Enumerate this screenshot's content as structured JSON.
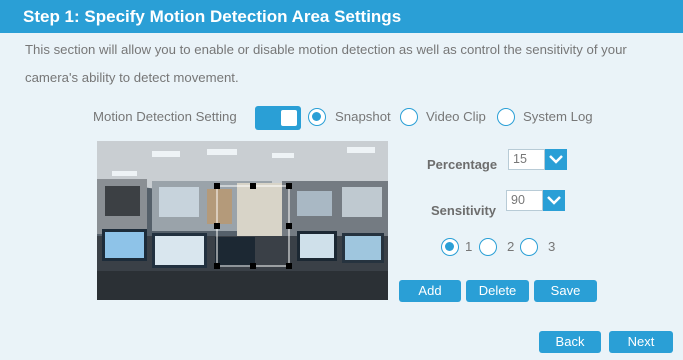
{
  "header": {
    "title": "Step 1: Specify Motion Detection Area Settings"
  },
  "description": {
    "line1": "This section will allow you to enable or disable motion detection as well as control the sensitivity of your",
    "line2": "camera's ability to detect movement."
  },
  "motion_detection": {
    "label": "Motion Detection Setting",
    "enabled": true,
    "options": [
      "Snapshot",
      "Video Clip",
      "System Log"
    ],
    "selected_option": "Snapshot"
  },
  "area": {
    "percentage_label": "Percentage",
    "percentage_value": "15",
    "sensitivity_label": "Sensitivity",
    "sensitivity_value": "90",
    "windows": [
      "1",
      "2",
      "3"
    ],
    "selected_window": "1"
  },
  "buttons": {
    "add": "Add",
    "delete": "Delete",
    "save": "Save",
    "back": "Back",
    "next": "Next"
  },
  "colors": {
    "accent": "#2a9fd6",
    "background": "#eaf3f8",
    "text": "#777777"
  }
}
